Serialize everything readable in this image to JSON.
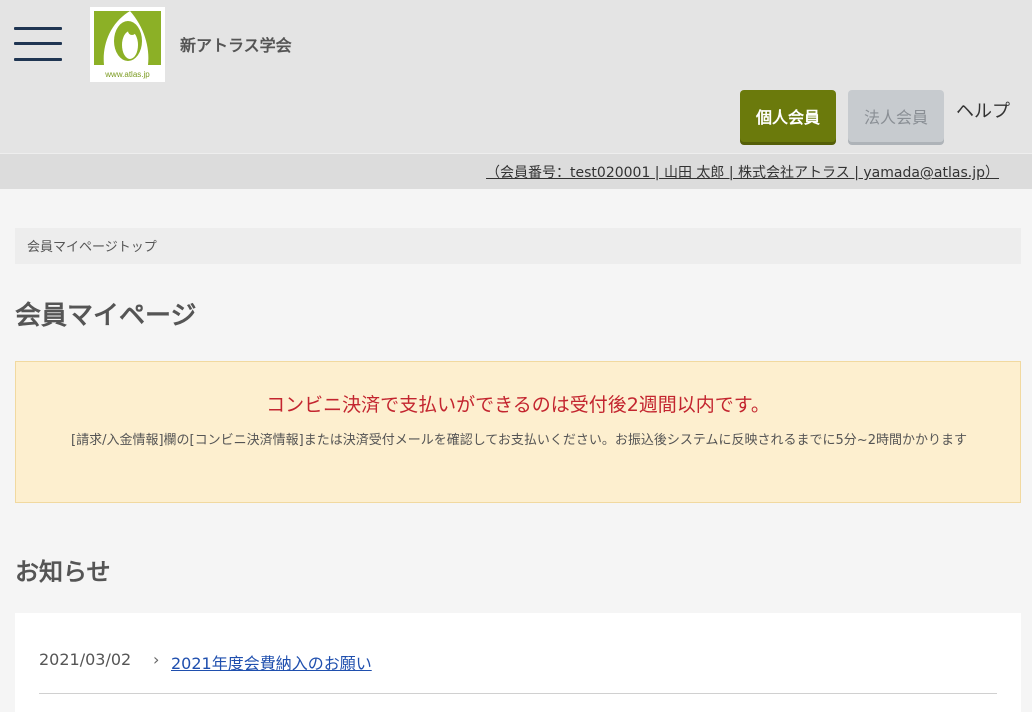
{
  "header": {
    "site_name": "新アトラス学会",
    "logo_url_text": "www.atlas.jp",
    "brand_color": "#8cb026",
    "personal_button": "個人会員",
    "corp_button": "法人会員",
    "help_link": "ヘルプ"
  },
  "userbar": {
    "info": "（会員番号：test020001 | 山田 太郎 | 株式会社アトラス | yamada@atlas.jp）"
  },
  "breadcrumb": {
    "current": "会員マイページトップ"
  },
  "page": {
    "title": "会員マイページ"
  },
  "alert": {
    "title": "コンビニ決済で支払いができるのは受付後2週間以内です。",
    "body": "[請求/入金情報]欄の[コンビニ決済情報]または決済受付メールを確認してお支払いください。お振込後システムに反映されるまでに5分~2時間かかります"
  },
  "news": {
    "heading": "お知らせ",
    "items": [
      {
        "date": "2021/03/02",
        "title": "2021年度会費納入のお願い"
      }
    ]
  }
}
